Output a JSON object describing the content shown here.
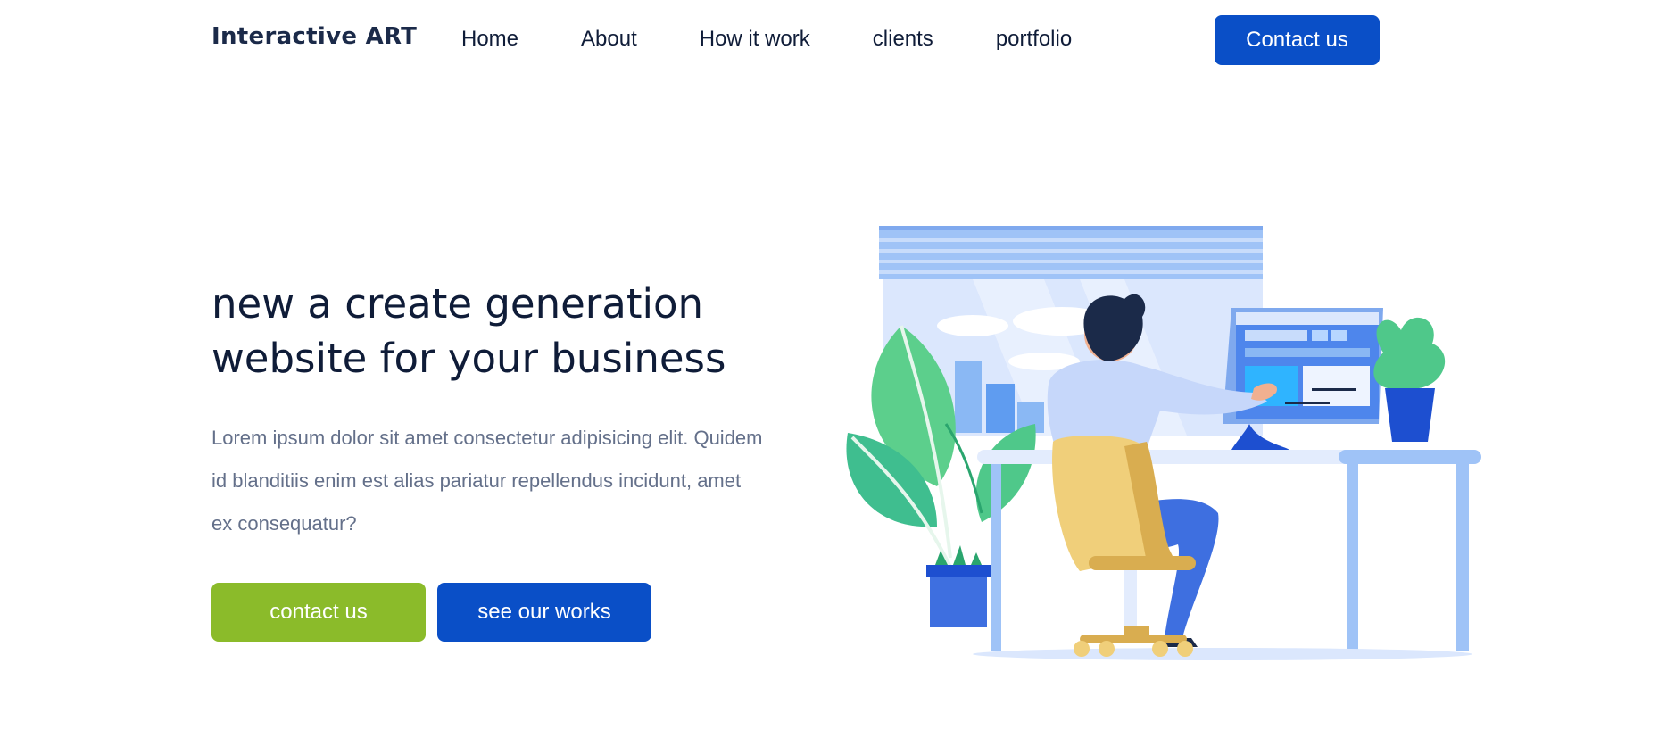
{
  "header": {
    "logo": "Interactive ART",
    "nav": [
      {
        "label": "Home"
      },
      {
        "label": "About"
      },
      {
        "label": "How it work"
      },
      {
        "label": "clients"
      },
      {
        "label": "portfolio"
      }
    ],
    "cta_label": "Contact us"
  },
  "hero": {
    "title": "new a create generation website for your business",
    "description": "Lorem ipsum dolor sit amet consectetur adipisicing elit. Quidem id blanditiis enim est alias pariatur repellendus incidunt, amet ex consequatur?",
    "primary_button": "contact us",
    "secondary_button": "see our works"
  },
  "colors": {
    "brand_blue": "#0a4fc7",
    "accent_green": "#8bbb2a",
    "heading": "#0f1c38",
    "body_text": "#64708a"
  },
  "illustration": {
    "icon": "person-at-desk-illustration"
  }
}
